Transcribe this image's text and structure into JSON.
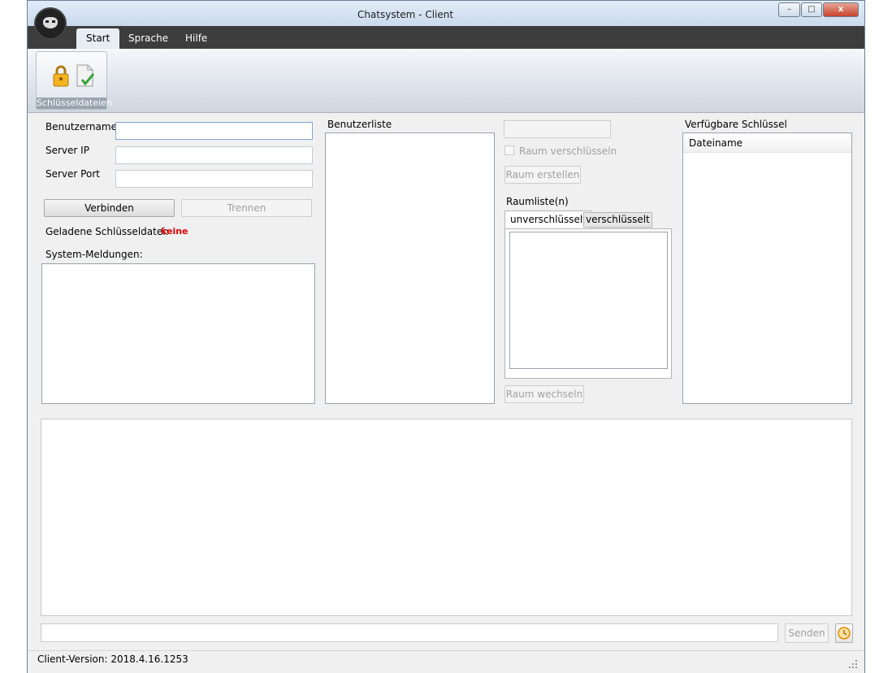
{
  "window": {
    "title": "Chatsystem - Client",
    "minimize": "–",
    "maximize": "□",
    "close": "x"
  },
  "menu": {
    "tabs": [
      "Start",
      "Sprache",
      "Hilfe"
    ]
  },
  "ribbon": {
    "group_label": "Schlüsseldateien"
  },
  "login": {
    "username_label": "Benutzername",
    "server_ip_label": "Server IP",
    "server_port_label": "Server Port",
    "username_value": "",
    "server_ip_value": "",
    "server_port_value": "",
    "connect_button": "Verbinden",
    "disconnect_button": "Trennen",
    "loaded_key_label": "Geladene Schlüsseldatei:",
    "loaded_key_value": "keine",
    "loaded_key_color": "#e00000",
    "system_messages_label": "System-Meldungen:"
  },
  "userlist": {
    "label": "Benutzerliste"
  },
  "rooms": {
    "room_name_value": "",
    "encrypt_checkbox_label": "Raum verschlüsseln",
    "create_button": "Raum erstellen",
    "roomlist_label": "Raumliste(n)",
    "tabs": [
      "unverschlüsselt",
      "verschlüsselt"
    ],
    "switch_button": "Raum wechseln"
  },
  "keys": {
    "label": "Verfügbare Schlüssel",
    "column_header": "Dateiname"
  },
  "chat": {
    "message_value": "",
    "send_button": "Senden"
  },
  "status": {
    "version": "Client-Version: 2018.4.16.1253"
  }
}
